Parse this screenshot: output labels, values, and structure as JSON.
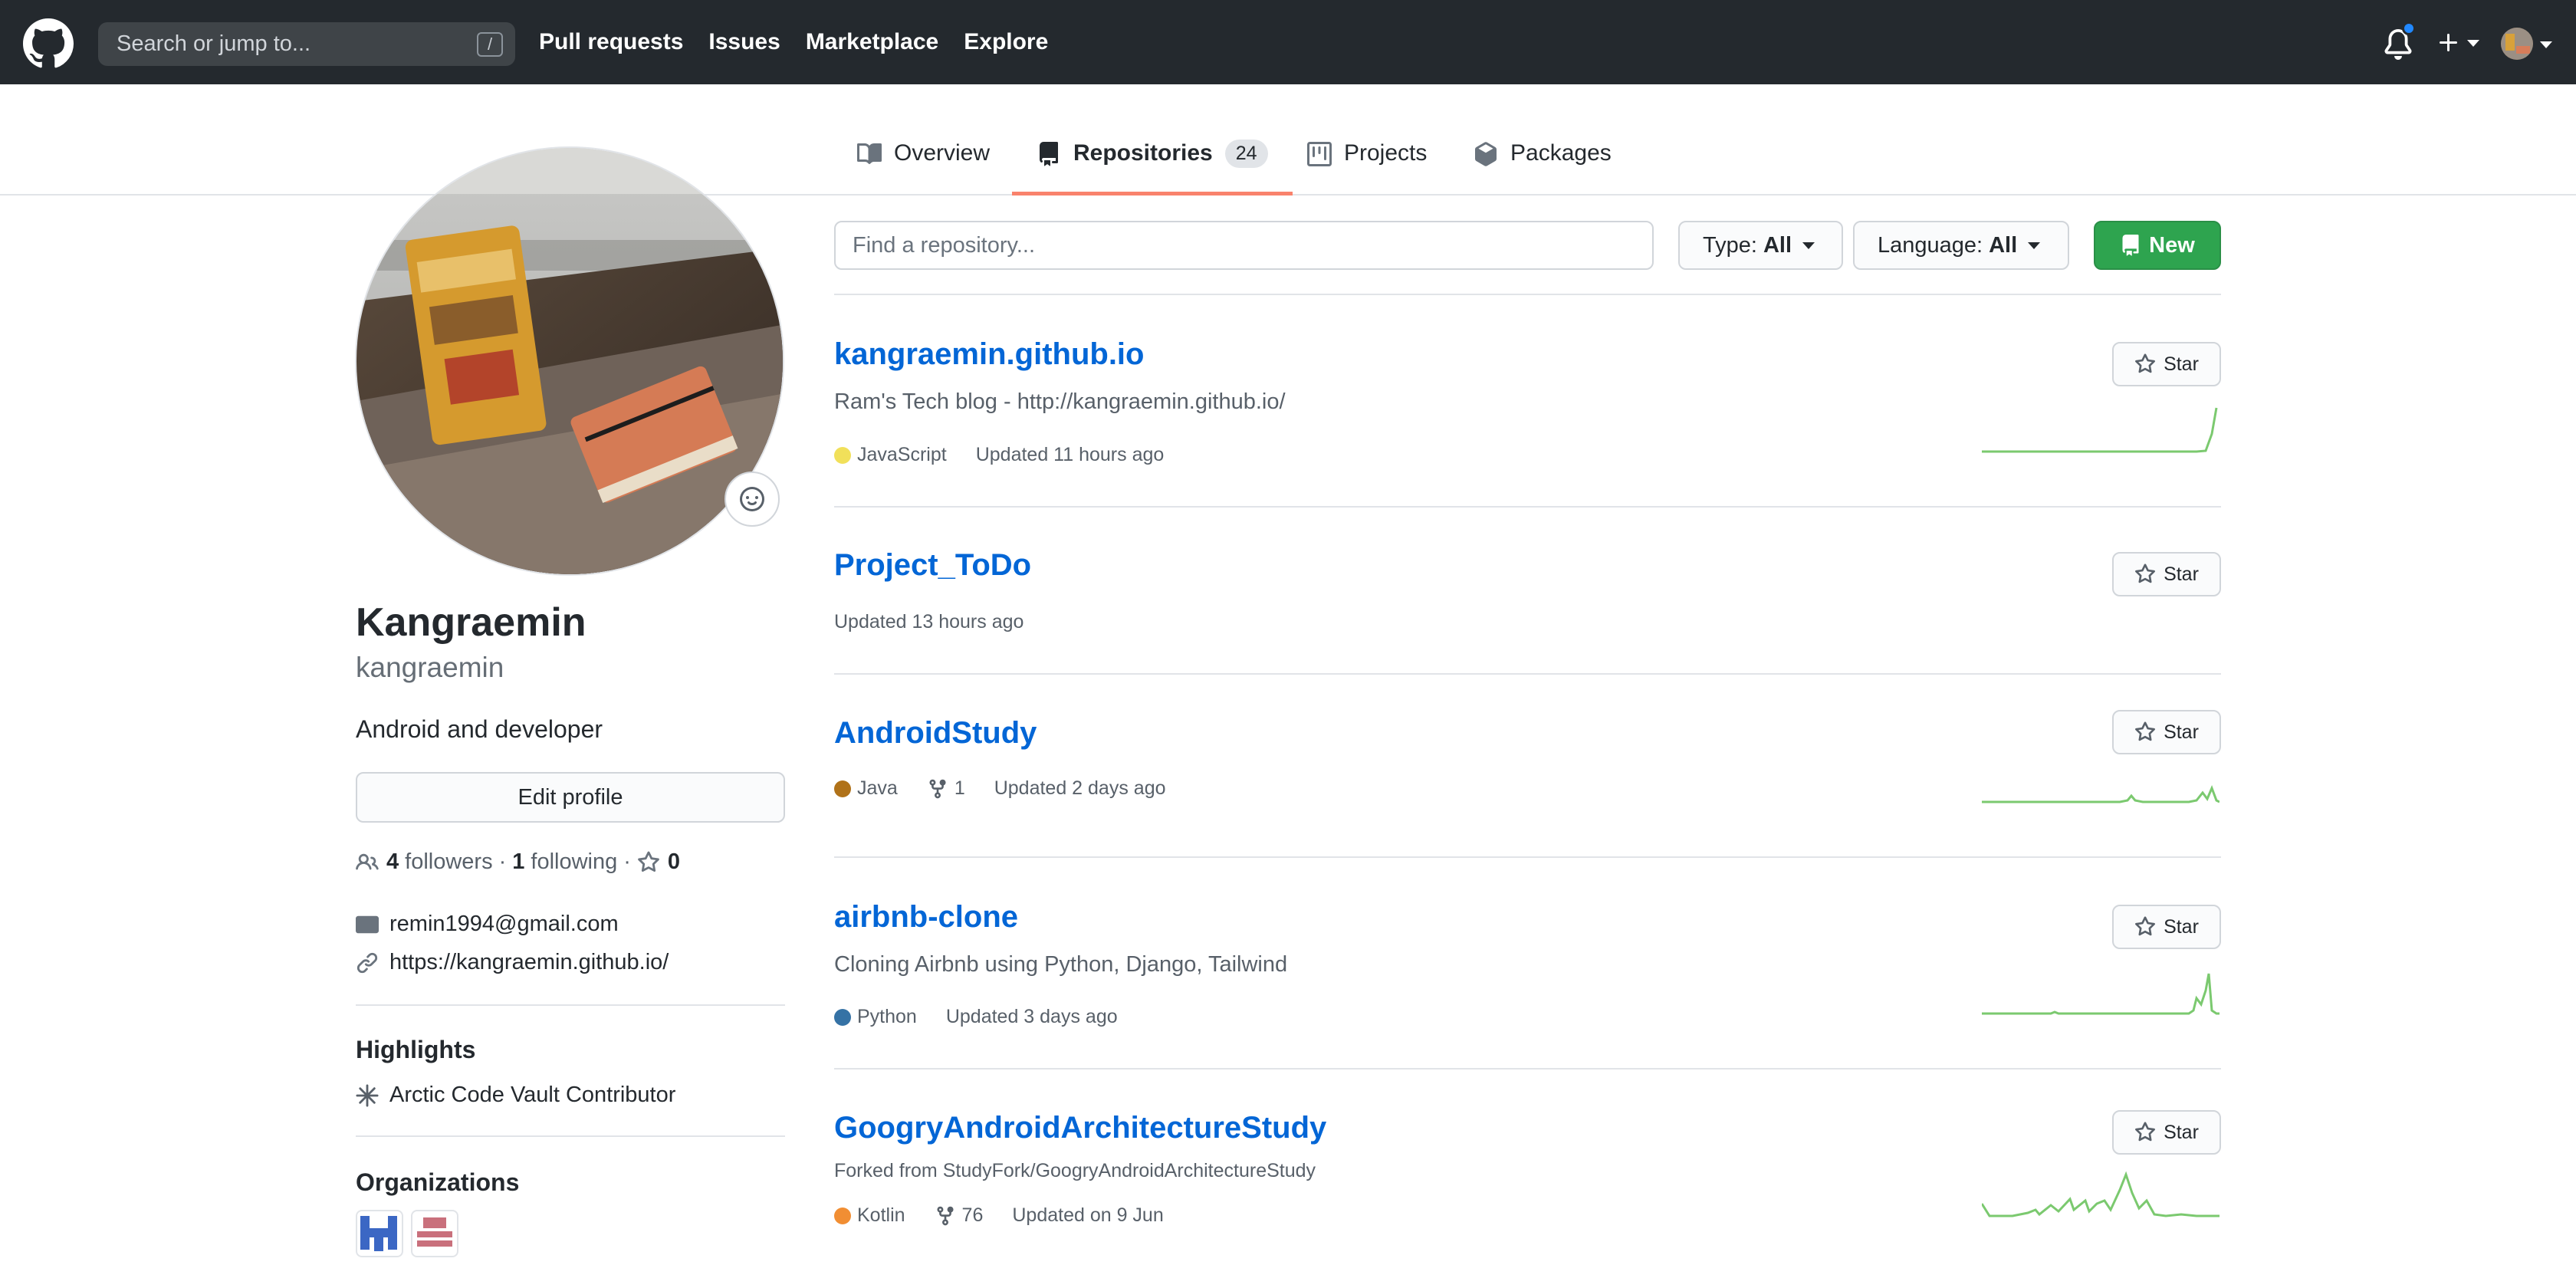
{
  "header": {
    "search_placeholder": "Search or jump to...",
    "search_shortcut": "/",
    "nav": [
      "Pull requests",
      "Issues",
      "Marketplace",
      "Explore"
    ]
  },
  "tabs": [
    {
      "label": "Overview"
    },
    {
      "label": "Repositories",
      "count": "24"
    },
    {
      "label": "Projects"
    },
    {
      "label": "Packages"
    }
  ],
  "profile": {
    "name": "Kangraemin",
    "login": "kangraemin",
    "bio": "Android and developer",
    "edit_label": "Edit profile",
    "followers_count": "4",
    "followers_label": "followers",
    "sep1": "·",
    "following_count": "1",
    "following_label": "following",
    "sep2": "·",
    "stars_count": "0",
    "email": "remin1994@gmail.com",
    "website": "https://kangraemin.github.io/",
    "highlights_title": "Highlights",
    "highlight": "Arctic Code Vault Contributor",
    "orgs_title": "Organizations"
  },
  "repo_controls": {
    "find_placeholder": "Find a repository...",
    "type_label": "Type:",
    "type_value": "All",
    "language_label": "Language:",
    "language_value": "All",
    "new_label": "New"
  },
  "repos": [
    {
      "name": "kangraemin.github.io",
      "description": "Ram's Tech blog - http://kangraemin.github.io/",
      "language": "JavaScript",
      "lang_color": "#f1e05a",
      "updated": "Updated 11 hours ago",
      "star": "Star"
    },
    {
      "name": "Project_ToDo",
      "updated": "Updated 13 hours ago",
      "star": "Star"
    },
    {
      "name": "AndroidStudy",
      "language": "Java",
      "lang_color": "#b07219",
      "forks": "1",
      "updated": "Updated 2 days ago",
      "star": "Star"
    },
    {
      "name": "airbnb-clone",
      "description": "Cloning Airbnb using Python, Django, Tailwind",
      "language": "Python",
      "lang_color": "#3572A5",
      "updated": "Updated 3 days ago",
      "star": "Star"
    },
    {
      "name": "GoogryAndroidArchitectureStudy",
      "forked_from": "Forked from StudyFork/GoogryAndroidArchitectureStudy",
      "language": "Kotlin",
      "lang_color": "#F18E33",
      "forks": "76",
      "updated": "Updated on 9 Jun",
      "star": "Star"
    }
  ],
  "colors": {
    "header_bg": "#24292e",
    "link": "#0366d6",
    "primary_button": "#2ea44f",
    "tab_underline": "#f9826c",
    "sparkline": "#7bc96f"
  }
}
